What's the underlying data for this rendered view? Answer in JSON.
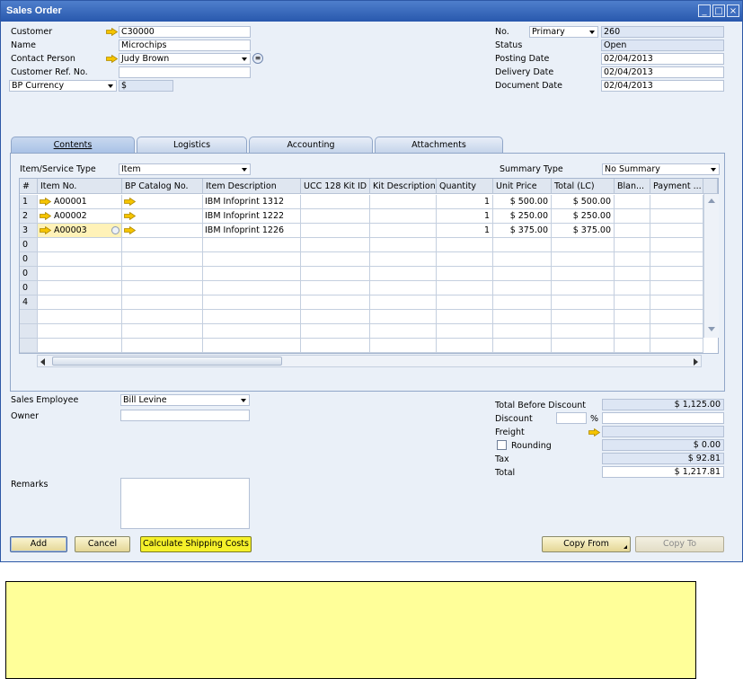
{
  "window": {
    "title": "Sales Order"
  },
  "header_left": {
    "customer_label": "Customer",
    "customer_value": "C30000",
    "name_label": "Name",
    "name_value": "Microchips",
    "contact_label": "Contact Person",
    "contact_value": "Judy Brown",
    "custref_label": "Customer Ref. No.",
    "custref_value": "",
    "currency_select": "BP Currency",
    "currency_value": "$"
  },
  "header_right": {
    "no_label": "No.",
    "series_value": "Primary",
    "no_value": "260",
    "status_label": "Status",
    "status_value": "Open",
    "posting_label": "Posting Date",
    "posting_value": "02/04/2013",
    "delivery_label": "Delivery Date",
    "delivery_value": "02/04/2013",
    "document_label": "Document Date",
    "document_value": "02/04/2013"
  },
  "tabs": [
    {
      "label": "Contents"
    },
    {
      "label": "Logistics"
    },
    {
      "label": "Accounting"
    },
    {
      "label": "Attachments"
    }
  ],
  "contents": {
    "item_type_label": "Item/Service Type",
    "item_type_value": "Item",
    "summary_label": "Summary Type",
    "summary_value": "No Summary",
    "columns": [
      "#",
      "Item No.",
      "BP Catalog No.",
      "Item Description",
      "UCC 128 Kit ID",
      "Kit Description",
      "Quantity",
      "Unit Price",
      "Total (LC)",
      "Blan...",
      "Payment ..."
    ],
    "rows": [
      {
        "num": "1",
        "item": "A00001",
        "desc": "IBM Infoprint 1312",
        "qty": "1",
        "price": "$ 500.00",
        "total": "$ 500.00"
      },
      {
        "num": "2",
        "item": "A00002",
        "desc": "IBM Infoprint 1222",
        "qty": "1",
        "price": "$ 250.00",
        "total": "$ 250.00"
      },
      {
        "num": "3",
        "item": "A00003",
        "desc": "IBM Infoprint 1226",
        "qty": "1",
        "price": "$ 375.00",
        "total": "$ 375.00"
      }
    ],
    "empty_row_nums": [
      "0",
      "0",
      "0",
      "0",
      "4",
      "",
      "",
      ""
    ]
  },
  "footer_left": {
    "sales_emp_label": "Sales Employee",
    "sales_emp_value": "Bill Levine",
    "owner_label": "Owner",
    "owner_value": "",
    "remarks_label": "Remarks"
  },
  "totals": {
    "before_discount_label": "Total Before Discount",
    "before_discount_value": "$ 1,125.00",
    "discount_label": "Discount",
    "discount_pct": "",
    "percent_sign": "%",
    "discount_value": "",
    "freight_label": "Freight",
    "freight_value": "",
    "rounding_label": "Rounding",
    "rounding_value": "$ 0.00",
    "tax_label": "Tax",
    "tax_value": "$ 92.81",
    "total_label": "Total",
    "total_value": "$ 1,217.81"
  },
  "buttons": {
    "add": "Add",
    "cancel": "Cancel",
    "shipping": "Calculate Shipping Costs",
    "copy_from": "Copy From",
    "copy_to": "Copy To"
  },
  "colors": {
    "link_arrow": "#f5c400",
    "title_bar": "#2d58a6",
    "highlight": "#ffff99"
  }
}
